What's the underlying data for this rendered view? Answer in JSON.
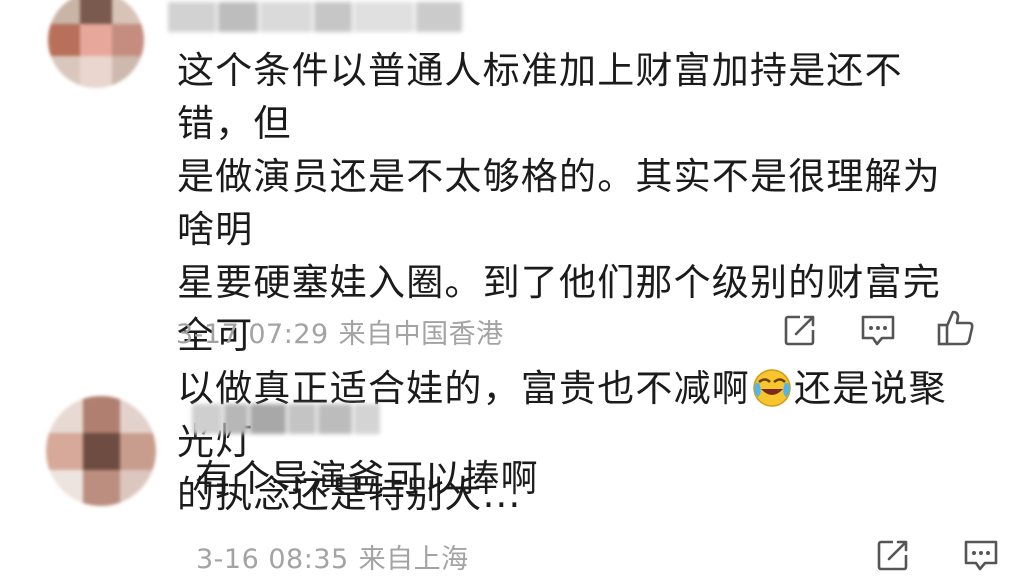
{
  "comments": [
    {
      "text_before_emoji": "这个条件以普通人标准加上财富加持是还不错，但\n是做演员还是不太够格的。其实不是很理解为啥明\n星要硬塞娃入圈。到了他们那个级别的财富完全可\n以做真正适合娃的，富贵也不减啊",
      "emoji": "laugh-cry-emoji",
      "text_after_emoji": "还是说聚光灯\n的执念还是特别大...",
      "date": "3-17 07:29",
      "location": "来自中国香港"
    },
    {
      "text": "有个导演爸可以捧啊",
      "date": "3-16 08:35",
      "location": "来自上海"
    }
  ],
  "colors": {
    "text": "#1b1b1b",
    "meta": "#a3a3a3",
    "icon": "#555555",
    "background": "#ffffff"
  },
  "icons": [
    "repost-icon",
    "comment-icon",
    "like-icon"
  ]
}
